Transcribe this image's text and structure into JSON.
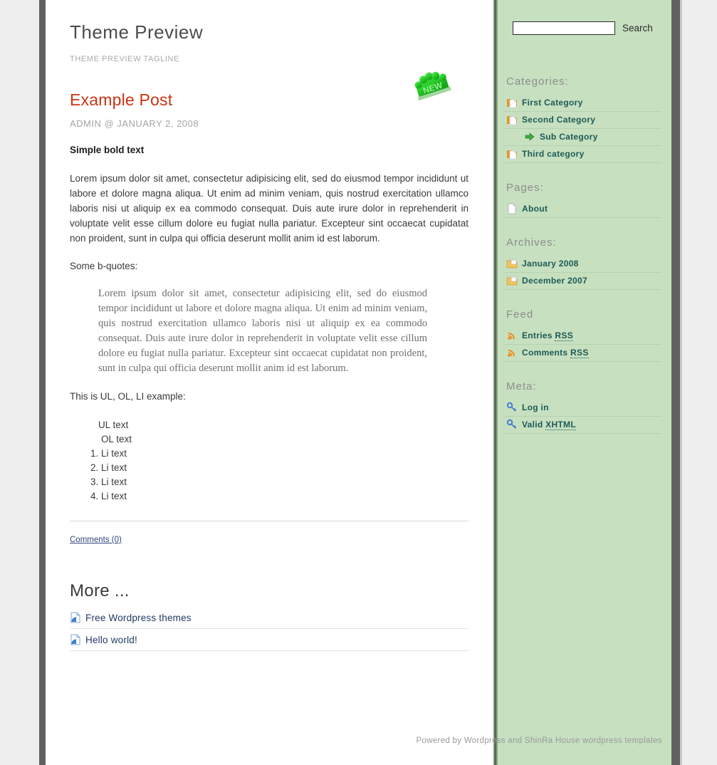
{
  "colors": {
    "page_background": "#eeeeee",
    "frame_rail": "#5f6163",
    "content_background": "#ffffff",
    "sidebar_background": "#c6e0c0",
    "post_title": "#cc3311",
    "sidebar_link": "#1f5a55",
    "widget_title": "#8d8d8d",
    "more_link": "#223a63",
    "badge_green": "#2ecc2e"
  },
  "header": {
    "title": "Theme Preview",
    "tagline": "THEME PREVIEW TAGLINE"
  },
  "post": {
    "badge_label": "NEW",
    "badge_icon": "new-starburst-badge",
    "title": "Example Post",
    "meta": "ADMIN @ JANUARY 2, 2008",
    "bold_text": "Simple bold text",
    "paragraph": "Lorem ipsum dolor sit amet, consectetur adipisicing elit, sed do eiusmod tempor incididunt ut labore et dolore magna aliqua. Ut enim ad minim veniam, quis nostrud exercitation ullamco laboris nisi ut aliquip ex ea commodo consequat. Duis aute irure dolor in reprehenderit in voluptate velit esse cillum dolore eu fugiat nulla pariatur. Excepteur sint occaecat cupidatat non proident, sunt in culpa qui officia deserunt mollit anim id est laborum.",
    "bquote_lead": "Some b-quotes:",
    "blockquote": "Lorem ipsum dolor sit amet, consectetur adipisicing elit, sed do eiusmod tempor incididunt ut labore et dolore magna aliqua. Ut enim ad minim veniam, quis nostrud exercitation ullamco laboris nisi ut aliquip ex ea commodo consequat. Duis aute irure dolor in reprehenderit in voluptate velit esse cillum dolore eu fugiat nulla pariatur. Excepteur sint occaecat cupidatat non proident, sunt in culpa qui officia deserunt mollit anim id est laborum.",
    "list_lead": "This is UL, OL, LI example:",
    "ul_text": "UL text",
    "ol_text": "OL text",
    "ol_items": [
      "Li text",
      "Li text",
      "Li text",
      "Li text"
    ],
    "comments_link": "Comments (0)"
  },
  "more": {
    "title": "More ...",
    "items": [
      {
        "label": "Free Wordpress themes",
        "icon": "page-curl-blue-icon"
      },
      {
        "label": "Hello world!",
        "icon": "page-curl-blue-icon"
      }
    ]
  },
  "sidebar": {
    "search": {
      "value": "",
      "placeholder": "",
      "button_label": "Search",
      "icon": "search-input"
    },
    "widgets": [
      {
        "title": "Categories:",
        "items": [
          {
            "label": "First Category",
            "icon": "folder-page-orange-icon",
            "sub": false
          },
          {
            "label": "Second Category",
            "icon": "folder-page-orange-icon",
            "sub": false
          },
          {
            "label": "Sub Category",
            "icon": "arrow-right-green-icon",
            "sub": true
          },
          {
            "label": "Third category",
            "icon": "folder-page-orange-icon",
            "sub": false
          }
        ]
      },
      {
        "title": "Pages:",
        "items": [
          {
            "label": "About",
            "icon": "page-white-icon",
            "sub": false
          }
        ]
      },
      {
        "title": "Archives:",
        "items": [
          {
            "label": "January 2008",
            "icon": "calendar-folder-icon",
            "sub": false
          },
          {
            "label": "December 2007",
            "icon": "calendar-folder-icon",
            "sub": false
          }
        ]
      },
      {
        "title": "Feed",
        "items": [
          {
            "label": "Entries ",
            "abbr": "RSS",
            "icon": "rss-orange-icon",
            "sub": false
          },
          {
            "label": "Comments ",
            "abbr": "RSS",
            "icon": "rss-orange-icon",
            "sub": false
          }
        ]
      },
      {
        "title": "Meta:",
        "items": [
          {
            "label": "Log in",
            "icon": "key-blue-icon",
            "sub": false
          },
          {
            "label": "Valid ",
            "abbr": "XHTML",
            "icon": "key-blue-icon",
            "sub": false
          }
        ]
      }
    ]
  },
  "footer": {
    "text": "Powered by Wordpress and ShinRa House wordpress templates"
  }
}
